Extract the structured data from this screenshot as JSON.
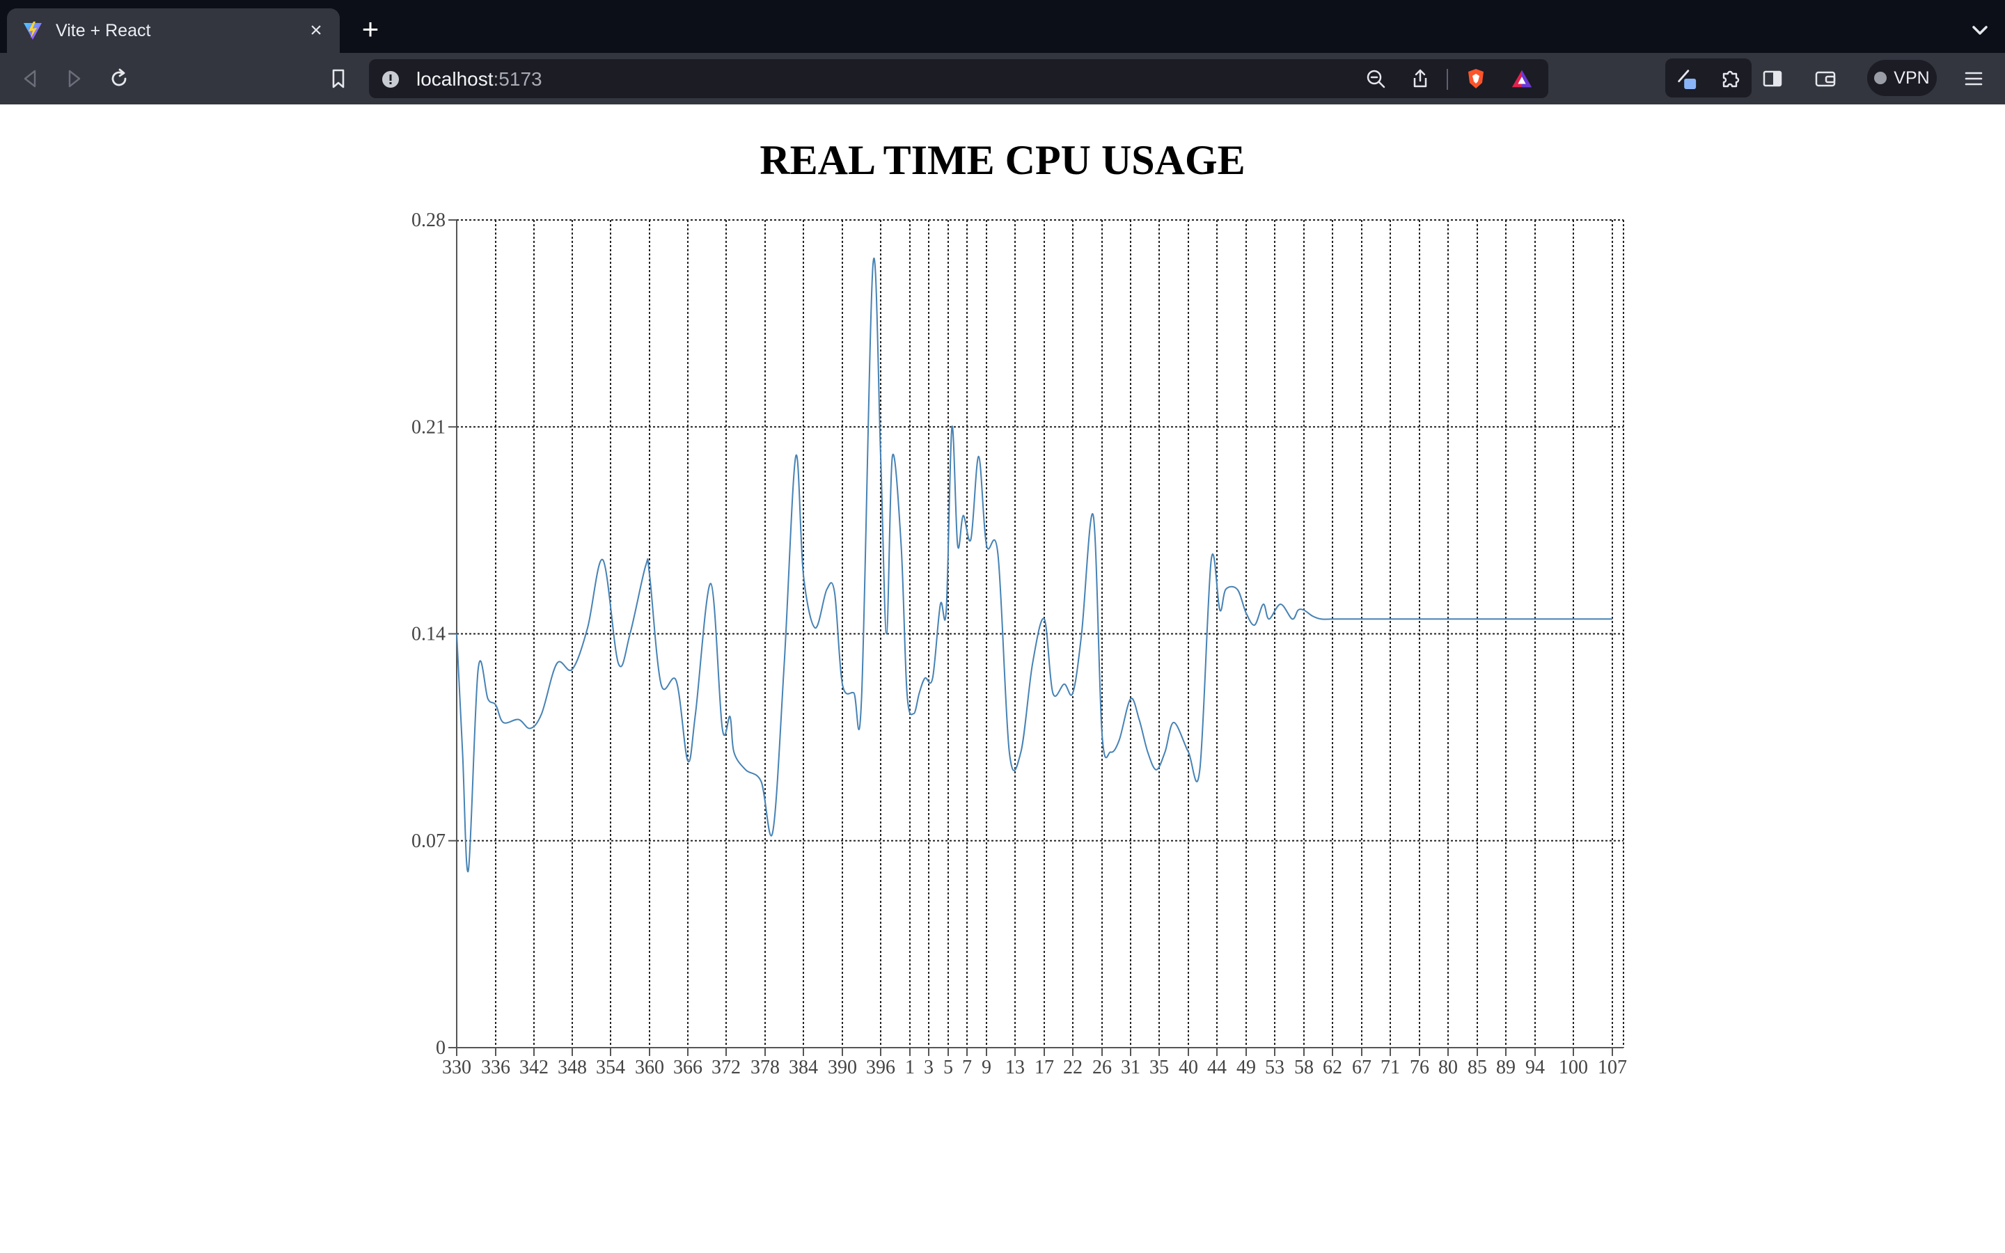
{
  "browser": {
    "tab_title": "Vite + React",
    "new_tab_symbol": "+",
    "close_symbol": "×",
    "url_host": "localhost",
    "url_port": ":5173",
    "vpn_label": "VPN",
    "icons": [
      "vite-favicon",
      "back-icon",
      "forward-icon",
      "reload-icon",
      "bookmark-icon",
      "site-info-icon",
      "zoom-out-icon",
      "share-icon",
      "brave-shields-icon",
      "brave-rewards-icon",
      "pen-extension-icon",
      "puzzle-extensions-icon",
      "sidebar-icon",
      "wallet-icon",
      "menu-icon",
      "tab-list-chevron-icon"
    ]
  },
  "chart_data": {
    "type": "line",
    "title": "REAL TIME CPU USAGE",
    "xlabel": "",
    "ylabel": "",
    "x_tick_labels": [
      "330",
      "336",
      "342",
      "348",
      "354",
      "360",
      "366",
      "372",
      "378",
      "384",
      "390",
      "396",
      "1",
      "3",
      "5",
      "7",
      "9",
      "13",
      "17",
      "22",
      "26",
      "31",
      "35",
      "40",
      "44",
      "49",
      "53",
      "58",
      "62",
      "67",
      "71",
      "76",
      "80",
      "85",
      "89",
      "94",
      "100",
      "107"
    ],
    "y_ticks": [
      0,
      0.07,
      0.14,
      0.21,
      0.28
    ],
    "y_tick_labels": [
      "0",
      "0.07",
      "0.14",
      "0.21",
      "0.28"
    ],
    "ylim": [
      0,
      0.28
    ],
    "grid": true,
    "line_color": "#4682b4",
    "series": [
      {
        "name": "",
        "note_x": "x values are positions along the tick sequence (0 = first tick '330', 37 = last tick '107')",
        "x": [
          0,
          0.15,
          0.3,
          0.55,
          0.8,
          1.0,
          1.2,
          1.6,
          1.9,
          2.2,
          2.6,
          3.0,
          3.4,
          3.8,
          4.2,
          4.5,
          4.9,
          5.0,
          5.3,
          5.7,
          6.0,
          6.2,
          6.6,
          6.9,
          7.1,
          7.2,
          7.5,
          7.9,
          8.2,
          8.5,
          8.8,
          9.0,
          9.3,
          9.6,
          9.8,
          10.0,
          10.3,
          10.5,
          10.8,
          11.0,
          11.2,
          11.4,
          11.7,
          11.9,
          12.2,
          12.5,
          12.8,
          13.2,
          13.6,
          13.9,
          14.2,
          14.5,
          14.8,
          15.2,
          15.6,
          16.0,
          16.4,
          16.8,
          17.2,
          17.6,
          18.0,
          18.3,
          18.7,
          19.0,
          19.3,
          19.7,
          20.0,
          20.3,
          20.6,
          21.0,
          21.3,
          21.6,
          21.9,
          22.2,
          22.5,
          23.0,
          23.4,
          23.8,
          24.1,
          24.3,
          24.7,
          25.0,
          25.3,
          25.6,
          25.8,
          26.2,
          26.6,
          26.8,
          27.0,
          27.3,
          27.6,
          28.0,
          28.4,
          28.8,
          29.2,
          29.6,
          30.0,
          30.3,
          30.6,
          31.0,
          31.3,
          31.6,
          32.0,
          32.4,
          32.8,
          33.2,
          33.6,
          34.0,
          34.4,
          34.7,
          35.0,
          35.3,
          35.6,
          35.9,
          36.2,
          36.5,
          36.8,
          37.0
        ],
        "y": [
          0.14,
          0.1,
          0.06,
          0.128,
          0.118,
          0.116,
          0.11,
          0.111,
          0.108,
          0.113,
          0.13,
          0.128,
          0.142,
          0.165,
          0.13,
          0.14,
          0.163,
          0.16,
          0.123,
          0.124,
          0.097,
          0.113,
          0.157,
          0.108,
          0.112,
          0.1,
          0.094,
          0.09,
          0.073,
          0.13,
          0.2,
          0.16,
          0.142,
          0.155,
          0.154,
          0.123,
          0.12,
          0.118,
          0.265,
          0.2,
          0.14,
          0.2,
          0.17,
          0.12,
          0.113,
          0.12,
          0.125,
          0.125,
          0.15,
          0.148,
          0.21,
          0.17,
          0.18,
          0.172,
          0.2,
          0.17,
          0.167,
          0.1,
          0.1,
          0.13,
          0.145,
          0.12,
          0.123,
          0.12,
          0.14,
          0.18,
          0.106,
          0.1,
          0.104,
          0.118,
          0.111,
          0.1,
          0.094,
          0.1,
          0.11,
          0.1,
          0.094,
          0.165,
          0.148,
          0.155,
          0.155,
          0.147,
          0.143,
          0.15,
          0.145,
          0.15,
          0.145,
          0.148,
          0.148,
          0.146,
          0.145,
          0.145,
          0.145,
          0.145,
          0.145,
          0.145,
          0.145,
          0.145,
          0.145,
          0.145,
          0.145,
          0.145,
          0.145,
          0.145,
          0.145,
          0.145,
          0.145,
          0.145,
          0.145,
          0.145,
          0.145,
          0.145,
          0.145,
          0.145,
          0.145,
          0.145,
          0.145,
          0.145
        ]
      }
    ]
  }
}
